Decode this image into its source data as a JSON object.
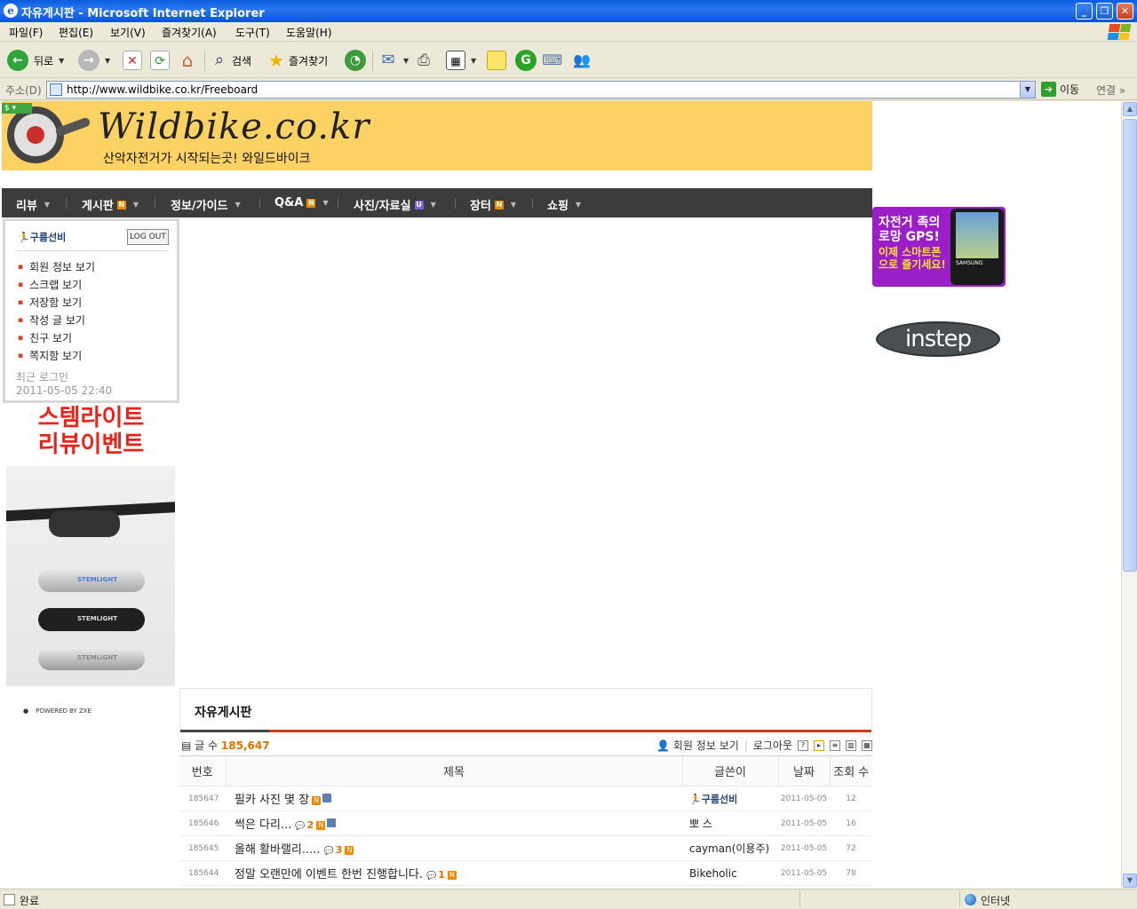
{
  "window": {
    "title": "자유게시판 - Microsoft Internet Explorer",
    "buttons": [
      "_",
      "❐",
      "✕"
    ]
  },
  "menu": [
    "파일(F)",
    "편집(E)",
    "보기(V)",
    "즐겨찾기(A)",
    "도구(T)",
    "도움말(H)"
  ],
  "toolbar": {
    "back_label": "뒤로",
    "search_label": "검색",
    "favorites_label": "즐겨찾기"
  },
  "address": {
    "label": "주소(D)",
    "url": "http://www.wildbike.co.kr/Freeboard",
    "go_label": "이동",
    "links_label": "연결"
  },
  "site": {
    "logo": "Wildbike.co.kr",
    "slogan": "산악자전거가 시작되는곳! 와일드바이크",
    "nav": [
      {
        "label": "리뷰",
        "badge": ""
      },
      {
        "label": "게시판",
        "badge": "N"
      },
      {
        "label": "정보/가이드",
        "badge": ""
      },
      {
        "label": "Q&A",
        "badge": "N"
      },
      {
        "label": "사진/자료실",
        "badge": "U"
      },
      {
        "label": "장터",
        "badge": "N"
      },
      {
        "label": "쇼핑",
        "badge": ""
      }
    ]
  },
  "login": {
    "username": "구름선비",
    "logout_label": "LOG OUT",
    "menu": [
      "회원 정보 보기",
      "스크랩 보기",
      "저장함 보기",
      "작성 글 보기",
      "친구 보기",
      "쪽지함 보기"
    ],
    "last_login_label": "최근 로그인",
    "last_login_time": "2011-05-05 22:40"
  },
  "promo": {
    "title_line1": "스템라이트",
    "title_line2": "리뷰이벤트",
    "product_label": "STEMLIGHT"
  },
  "powered": "POWERED BY ZXE",
  "ads": {
    "gps_line1": "자전거 족의",
    "gps_line2": "로망 GPS!",
    "gps_line3": "이제 스마트폰",
    "gps_line4": "으로 즐기세요!",
    "gps_brand": "SAMSUNG",
    "instep": "instep"
  },
  "board": {
    "title": "자유게시판",
    "count_label": "글 수",
    "count": "185,647",
    "member_info": "회원 정보 보기",
    "logout": "로그아웃",
    "columns": [
      "번호",
      "제목",
      "글쓴이",
      "날짜",
      "조회 수"
    ],
    "rows": [
      {
        "no": "185647",
        "subject": "필카 사진 몇 장",
        "comments": "",
        "new": true,
        "file": true,
        "author": "구름선비",
        "date": "2011-05-05",
        "views": "12"
      },
      {
        "no": "185646",
        "subject": "썩은 다리...",
        "comments": "2",
        "new": true,
        "file": true,
        "author": "뽀 스",
        "date": "2011-05-05",
        "views": "16"
      },
      {
        "no": "185645",
        "subject": "올해 활바랠리.....",
        "comments": "3",
        "new": true,
        "file": false,
        "author": "cayman(이용주)",
        "date": "2011-05-05",
        "views": "72"
      },
      {
        "no": "185644",
        "subject": "정말 오랜만에 이벤트 한번 진행합니다.",
        "comments": "1",
        "new": true,
        "file": false,
        "author": "Bikeholic",
        "date": "2011-05-05",
        "views": "78"
      }
    ]
  },
  "status": {
    "text": "완료",
    "zone": "인터넷"
  }
}
